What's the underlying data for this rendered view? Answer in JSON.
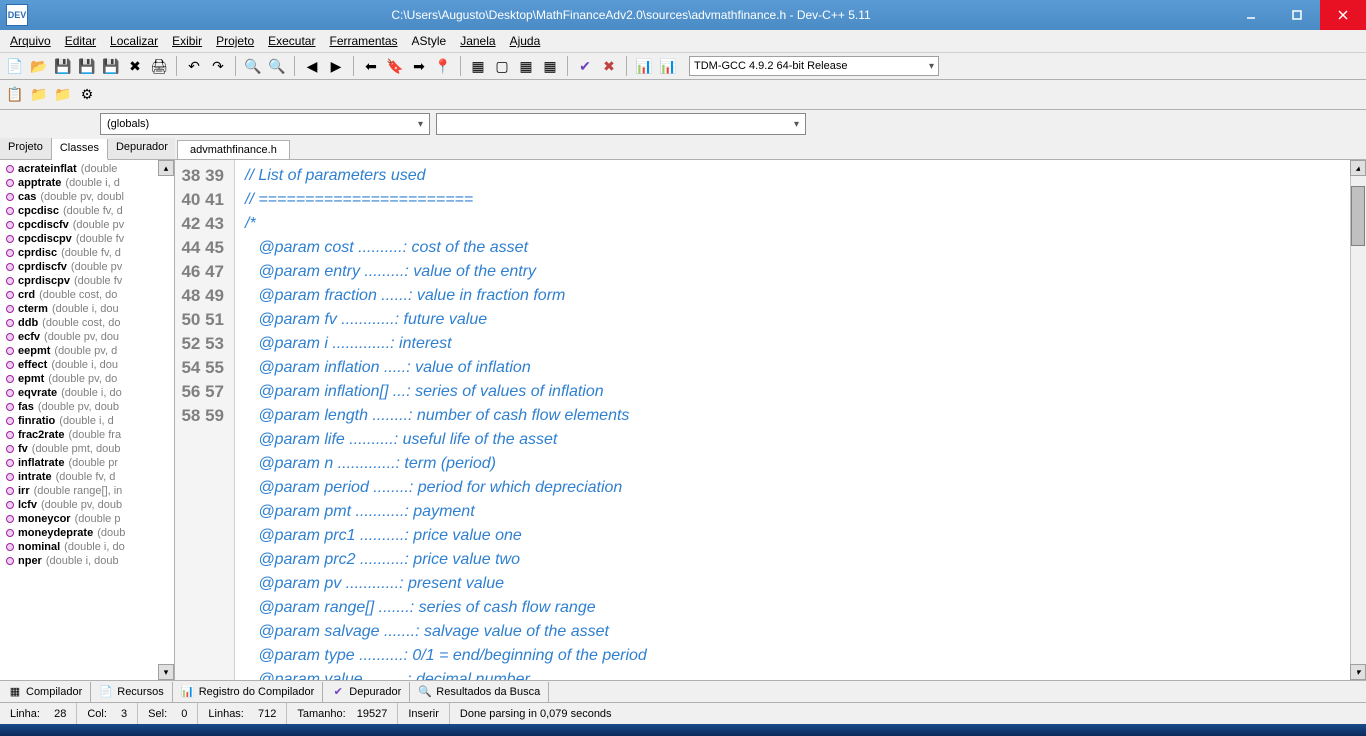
{
  "window": {
    "title": "C:\\Users\\Augusto\\Desktop\\MathFinanceAdv2.0\\sources\\advmathfinance.h - Dev-C++ 5.11",
    "app_short": "DEV"
  },
  "menu": {
    "items": [
      "Arquivo",
      "Editar",
      "Localizar",
      "Exibir",
      "Projeto",
      "Executar",
      "Ferramentas",
      "AStyle",
      "Janela",
      "Ajuda"
    ]
  },
  "compiler_combo": "TDM-GCC 4.9.2 64-bit Release",
  "scope_combo": "(globals)",
  "side_tabs": {
    "projeto": "Projeto",
    "classes": "Classes",
    "depurador": "Depurador"
  },
  "classes": [
    {
      "name": "acrateinflat",
      "sig": "(double"
    },
    {
      "name": "apptrate",
      "sig": "(double i, d"
    },
    {
      "name": "cas",
      "sig": "(double pv, doubl"
    },
    {
      "name": "cpcdisc",
      "sig": "(double fv, d"
    },
    {
      "name": "cpcdiscfv",
      "sig": "(double pv"
    },
    {
      "name": "cpcdiscpv",
      "sig": "(double fv"
    },
    {
      "name": "cprdisc",
      "sig": "(double fv, d"
    },
    {
      "name": "cprdiscfv",
      "sig": "(double pv"
    },
    {
      "name": "cprdiscpv",
      "sig": "(double fv"
    },
    {
      "name": "crd",
      "sig": "(double cost, do"
    },
    {
      "name": "cterm",
      "sig": "(double i, dou"
    },
    {
      "name": "ddb",
      "sig": "(double cost, do"
    },
    {
      "name": "ecfv",
      "sig": "(double pv, dou"
    },
    {
      "name": "eepmt",
      "sig": "(double pv, d"
    },
    {
      "name": "effect",
      "sig": "(double i, dou"
    },
    {
      "name": "epmt",
      "sig": "(double pv, do"
    },
    {
      "name": "eqvrate",
      "sig": "(double i, do"
    },
    {
      "name": "fas",
      "sig": "(double pv, doub"
    },
    {
      "name": "finratio",
      "sig": "(double i, d"
    },
    {
      "name": "frac2rate",
      "sig": "(double fra"
    },
    {
      "name": "fv",
      "sig": "(double pmt, doub"
    },
    {
      "name": "inflatrate",
      "sig": "(double pr"
    },
    {
      "name": "intrate",
      "sig": "(double fv, d"
    },
    {
      "name": "irr",
      "sig": "(double range[], in"
    },
    {
      "name": "lcfv",
      "sig": "(double pv, doub"
    },
    {
      "name": "moneycor",
      "sig": "(double p"
    },
    {
      "name": "moneydeprate",
      "sig": "(doub"
    },
    {
      "name": "nominal",
      "sig": "(double i, do"
    },
    {
      "name": "nper",
      "sig": "(double i, doub"
    }
  ],
  "file_tab": "advmathfinance.h",
  "code_lines": [
    {
      "n": "38",
      "t": "// List of parameters used"
    },
    {
      "n": "39",
      "t": "// ======================="
    },
    {
      "n": "40",
      "t": "/*"
    },
    {
      "n": "41",
      "t": "   @param cost ..........: cost of the asset"
    },
    {
      "n": "42",
      "t": "   @param entry .........: value of the entry"
    },
    {
      "n": "43",
      "t": "   @param fraction ......: value in fraction form"
    },
    {
      "n": "44",
      "t": "   @param fv ............: future value"
    },
    {
      "n": "45",
      "t": "   @param i .............: interest"
    },
    {
      "n": "46",
      "t": "   @param inflation .....: value of inflation"
    },
    {
      "n": "47",
      "t": "   @param inflation[] ...: series of values of inflation"
    },
    {
      "n": "48",
      "t": "   @param length ........: number of cash flow elements"
    },
    {
      "n": "49",
      "t": "   @param life ..........: useful life of the asset"
    },
    {
      "n": "50",
      "t": "   @param n .............: term (period)"
    },
    {
      "n": "51",
      "t": "   @param period ........: period for which depreciation"
    },
    {
      "n": "52",
      "t": "   @param pmt ...........: payment"
    },
    {
      "n": "53",
      "t": "   @param prc1 ..........: price value one"
    },
    {
      "n": "54",
      "t": "   @param prc2 ..........: price value two"
    },
    {
      "n": "55",
      "t": "   @param pv ............: present value"
    },
    {
      "n": "56",
      "t": "   @param range[] .......: series of cash flow range"
    },
    {
      "n": "57",
      "t": "   @param salvage .......: salvage value of the asset"
    },
    {
      "n": "58",
      "t": "   @param type ..........: 0/1 = end/beginning of the period"
    },
    {
      "n": "59",
      "t": "   @param value .........: decimal number"
    }
  ],
  "bottom_tabs": {
    "compilador": "Compilador",
    "recursos": "Recursos",
    "registro": "Registro do Compilador",
    "depurador": "Depurador",
    "resultados": "Resultados da Busca"
  },
  "status": {
    "linha_label": "Linha:",
    "linha": "28",
    "col_label": "Col:",
    "col": "3",
    "sel_label": "Sel:",
    "sel": "0",
    "linhas_label": "Linhas:",
    "linhas": "712",
    "tam_label": "Tamanho:",
    "tam": "19527",
    "inserir": "Inserir",
    "parse": "Done parsing in 0,079 seconds"
  }
}
